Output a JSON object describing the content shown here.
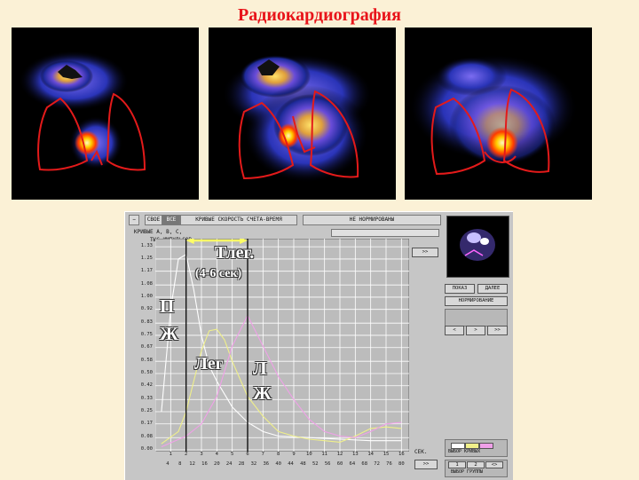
{
  "title": "Радиокардиография",
  "scans": [
    {
      "id": "scan-1",
      "phase": "early"
    },
    {
      "id": "scan-2",
      "phase": "middle"
    },
    {
      "id": "scan-3",
      "phase": "late"
    }
  ],
  "toolbar": {
    "btn_a": "СВОЕ",
    "btn_b": "ВСЕ",
    "chart_mode": "КРИВЫЕ СКОРОСТЬ СЧЕТА-ВРЕМЯ",
    "normalization": "НЕ НОРМИРОВАНЫ"
  },
  "subbar": {
    "curves_label": "КРИВЫЕ А, В, С,",
    "units_label": "ТЫС.ИМПУЛЬСОВ"
  },
  "side": {
    "forward_btn": ">>",
    "btn_show": "ПОКАЗ",
    "btn_next": "ДАЛЕЕ",
    "btn_normalize": "НОРМИРОВАНИЕ",
    "nav_left": "<",
    "nav_mid": ">",
    "nav_right": ">>",
    "legend_label": "ВЫБОР КРИВЫХ",
    "group_a": "1",
    "group_b": "2",
    "group_c": "<>",
    "group_label": "ВЫБОР ГРУППЫ"
  },
  "bottom": {
    "sec_label": "СЕК.",
    "forward_btn": ">>"
  },
  "annotations": {
    "t_transit": "Тлег.",
    "t_range": "(4-6 сек)",
    "rv_1": "П",
    "rv_2": "Ж",
    "lungs": "Лег",
    "lv_1": "Л",
    "lv_2": "Ж"
  },
  "colors": {
    "title": "#e8141a",
    "curve_rv": "#ffffff",
    "curve_lung": "#f0f08a",
    "curve_lv": "#f0a0e8",
    "plot_bg": "#bcbcbc",
    "grid": "#ffffff",
    "marker_arrow": "#ffff66"
  },
  "chart_data": {
    "type": "line",
    "x_ticks": [
      "1",
      "2",
      "3",
      "4",
      "5",
      "6",
      "7",
      "8",
      "9",
      "10",
      "11",
      "12",
      "13",
      "14",
      "15",
      "16"
    ],
    "x_ticks_bottom": [
      "4",
      "8",
      "12",
      "16",
      "20",
      "24",
      "28",
      "32",
      "36",
      "40",
      "44",
      "48",
      "52",
      "56",
      "60",
      "64",
      "68",
      "72",
      "76",
      "80"
    ],
    "y_ticks": [
      "1.33",
      "1.25",
      "1.17",
      "1.08",
      "1.00",
      "0.92",
      "0.83",
      "0.75",
      "0.67",
      "0.58",
      "0.50",
      "0.42",
      "0.33",
      "0.25",
      "0.17",
      "0.08",
      "0.00"
    ],
    "xlabel": "СЕК.",
    "ylabel": "ТЫС.ИМПУЛЬСОВ",
    "xlim": [
      0,
      16.5
    ],
    "ylim": [
      0,
      1.36
    ],
    "grid": true,
    "series": [
      {
        "key": "rv",
        "x": [
          0.4,
          1.0,
          1.5,
          2.0,
          2.5,
          3.0,
          3.5,
          4.0,
          5.0,
          6.0,
          7.0,
          8.0,
          10.0,
          12.0,
          14.0,
          16.0
        ],
        "values": [
          0.25,
          0.92,
          1.25,
          1.28,
          1.05,
          0.75,
          0.55,
          0.45,
          0.28,
          0.18,
          0.12,
          0.09,
          0.08,
          0.07,
          0.06,
          0.06
        ]
      },
      {
        "key": "lung",
        "x": [
          0.4,
          1.5,
          2.0,
          2.5,
          3.0,
          3.5,
          4.0,
          4.5,
          5.0,
          6.0,
          7.0,
          8.0,
          9.0,
          10.0,
          11.0,
          12.0,
          13.0,
          14.0,
          15.0,
          16.0
        ],
        "values": [
          0.04,
          0.12,
          0.25,
          0.45,
          0.65,
          0.78,
          0.79,
          0.72,
          0.58,
          0.35,
          0.22,
          0.12,
          0.09,
          0.07,
          0.06,
          0.05,
          0.09,
          0.14,
          0.15,
          0.14
        ]
      },
      {
        "key": "lv",
        "x": [
          0.4,
          2.0,
          3.0,
          4.0,
          5.0,
          6.0,
          7.0,
          8.0,
          9.0,
          10.0,
          11.0,
          12.0,
          13.0,
          14.0,
          15.0,
          16.0
        ],
        "values": [
          0.02,
          0.09,
          0.17,
          0.35,
          0.68,
          0.88,
          0.68,
          0.48,
          0.33,
          0.2,
          0.12,
          0.09,
          0.08,
          0.12,
          0.17,
          0.18
        ]
      }
    ]
  }
}
